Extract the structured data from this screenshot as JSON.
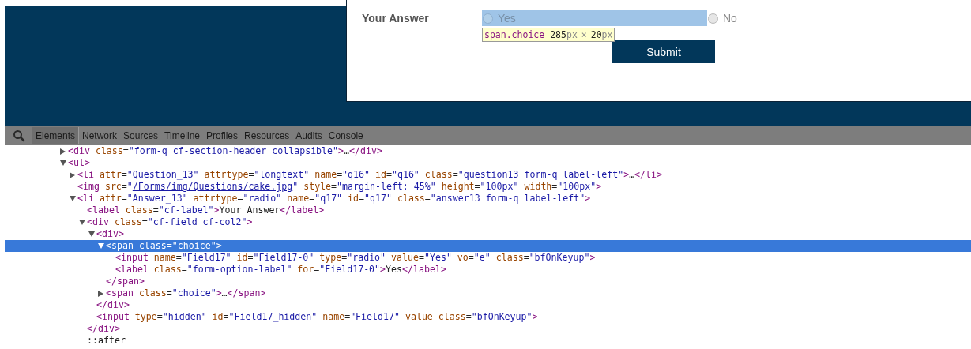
{
  "form": {
    "question_label": "Your Answer",
    "choices": [
      {
        "label": "Yes",
        "checked": false,
        "highlighted": true
      },
      {
        "label": "No",
        "checked": false,
        "highlighted": false
      }
    ],
    "inspect_tooltip": [
      {
        "kind": "selector",
        "text": "span.choice"
      },
      {
        "kind": "number",
        "text": "285"
      },
      {
        "kind": "unit",
        "text": "px"
      },
      {
        "kind": "sign",
        "text": "×"
      },
      {
        "kind": "number",
        "text": "20"
      },
      {
        "kind": "unit",
        "text": "px"
      }
    ],
    "submit_label": "Submit"
  },
  "devtools": {
    "tabs": [
      {
        "label": "Elements",
        "selected": true
      },
      {
        "label": "Network",
        "selected": false
      },
      {
        "label": "Sources",
        "selected": false
      },
      {
        "label": "Timeline",
        "selected": false
      },
      {
        "label": "Profiles",
        "selected": false
      },
      {
        "label": "Resources",
        "selected": false
      },
      {
        "label": "Audits",
        "selected": false
      },
      {
        "label": "Console",
        "selected": false
      }
    ],
    "dom_tree": [
      {
        "text": "<div class=\"form-q cf-section-header collapsible\">…</div>",
        "expanded": false,
        "selected": false
      },
      {
        "text": "<ul>",
        "expanded": true,
        "selected": false,
        "children": [
          {
            "text": "<li attr=\"Question_13\" attrtype=\"longtext\" name=\"q16\" id=\"q16\" class=\"question13 form-q label-left\">…</li>",
            "expanded": false,
            "selected": false
          },
          {
            "text": "<img src=\"/Forms/img/Questions/cake.jpg\" style=\"margin-left: 45%\" height=\"100px\" width=\"100px\">",
            "link_value": true,
            "selected": false
          },
          {
            "text": "<li attr=\"Answer_13\" attrtype=\"radio\" name=\"q17\" id=\"q17\" class=\"answer13 form-q label-left\">",
            "expanded": true,
            "selected": false,
            "children": [
              {
                "text": "<label class=\"cf-label\">Your Answer</label>",
                "selected": false
              },
              {
                "text": "<div class=\"cf-field cf-col2\">",
                "expanded": true,
                "selected": false,
                "children": [
                  {
                    "text": "<div>",
                    "expanded": true,
                    "selected": false,
                    "children": [
                      {
                        "text": "<span class=\"choice\">",
                        "expanded": true,
                        "selected": true,
                        "children": [
                          {
                            "text": "<input name=\"Field17\" id=\"Field17-0\" type=\"radio\" value=\"Yes\" vo=\"e\" class=\"bfOnKeyup\">",
                            "selected": false
                          },
                          {
                            "text": "<label class=\"form-option-label\" for=\"Field17-0\">Yes</label>",
                            "selected": false
                          }
                        ]
                      },
                      {
                        "text": "</span>",
                        "selected": false
                      },
                      {
                        "text": "<span class=\"choice\">…</span>",
                        "expanded": false,
                        "selected": false
                      }
                    ]
                  },
                  {
                    "text": "</div>",
                    "selected": false
                  },
                  {
                    "text": "<input type=\"hidden\" id=\"Field17_hidden\" name=\"Field17\" value class=\"bfOnKeyup\">",
                    "selected": false
                  }
                ]
              },
              {
                "text": "</div>",
                "selected": false
              },
              {
                "text": "::after",
                "selected": false
              }
            ]
          }
        ]
      }
    ]
  }
}
